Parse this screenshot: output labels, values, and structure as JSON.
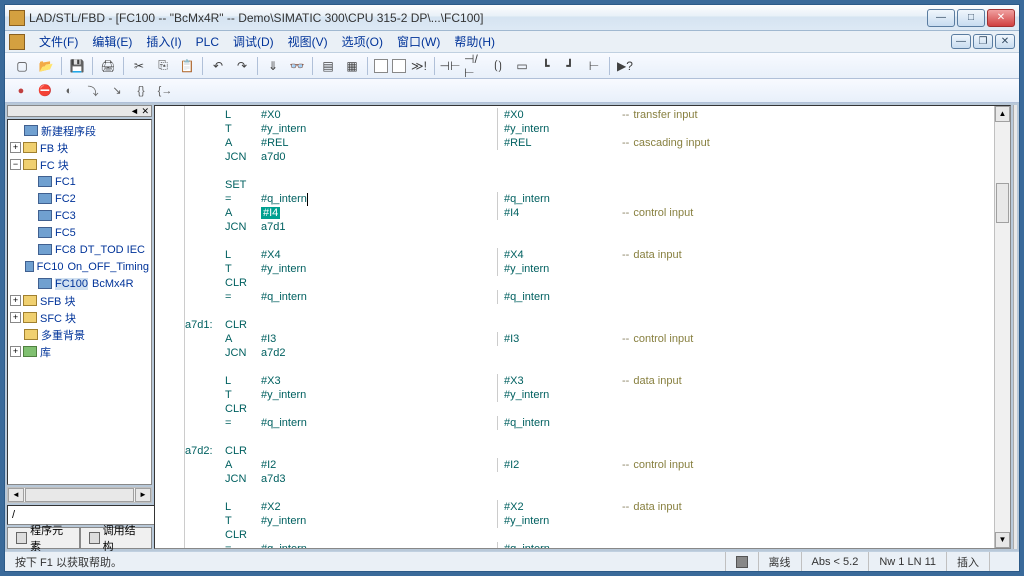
{
  "title": "LAD/STL/FBD  - [FC100 -- \"BcMx4R\" -- Demo\\SIMATIC 300\\CPU 315-2 DP\\...\\FC100]",
  "menu": {
    "file": "文件(F)",
    "edit": "编辑(E)",
    "insert": "插入(I)",
    "plc": "PLC",
    "debug": "调试(D)",
    "view": "视图(V)",
    "options": "选项(O)",
    "window": "窗口(W)",
    "help": "帮助(H)"
  },
  "tree": {
    "n0": "新建程序段",
    "n1": "FB 块",
    "n2": "FC 块",
    "fc1": "FC1",
    "fc2": "FC2",
    "fc3": "FC3",
    "fc5": "FC5",
    "fc8": "FC8",
    "fc8x": "DT_TOD   IEC",
    "fc10": "FC10",
    "fc10x": "On_OFF_Timing",
    "fc100": "FC100",
    "fc100x": "BcMx4R",
    "sfb": "SFB 块",
    "sfc": "SFC 块",
    "overlap": "多重背景",
    "lib": "库"
  },
  "tabs": {
    "elem": "程序元素",
    "call": "调用结构"
  },
  "code": [
    {
      "op": "L",
      "arg": "#X0",
      "ref": "#X0",
      "dash": "--",
      "cmt": "transfer input"
    },
    {
      "op": "T",
      "arg": "#y_intern",
      "ref": "#y_intern"
    },
    {
      "op": "A",
      "arg": "#REL",
      "ref": "#REL",
      "dash": "--",
      "cmt": "cascading input"
    },
    {
      "op": "JCN",
      "arg": "a7d0"
    },
    {},
    {
      "op": "SET"
    },
    {
      "op": "=",
      "arg": "#q_intern",
      "ref": "#q_intern",
      "caret": true
    },
    {
      "op": "A",
      "arg": "#I4",
      "ref": "#I4",
      "dash": "--",
      "cmt": "control input",
      "hilite": true
    },
    {
      "op": "JCN",
      "arg": "a7d1"
    },
    {},
    {
      "op": "L",
      "arg": "#X4",
      "ref": "#X4",
      "dash": "--",
      "cmt": "data input"
    },
    {
      "op": "T",
      "arg": "#y_intern",
      "ref": "#y_intern"
    },
    {
      "op": "CLR"
    },
    {
      "op": "=",
      "arg": "#q_intern",
      "ref": "#q_intern"
    },
    {},
    {
      "lbl": "a7d1:",
      "op": "CLR"
    },
    {
      "op": "A",
      "arg": "#I3",
      "ref": "#I3",
      "dash": "--",
      "cmt": "control input"
    },
    {
      "op": "JCN",
      "arg": "a7d2"
    },
    {},
    {
      "op": "L",
      "arg": "#X3",
      "ref": "#X3",
      "dash": "--",
      "cmt": "data input"
    },
    {
      "op": "T",
      "arg": "#y_intern",
      "ref": "#y_intern"
    },
    {
      "op": "CLR"
    },
    {
      "op": "=",
      "arg": "#q_intern",
      "ref": "#q_intern"
    },
    {},
    {
      "lbl": "a7d2:",
      "op": "CLR"
    },
    {
      "op": "A",
      "arg": "#I2",
      "ref": "#I2",
      "dash": "--",
      "cmt": "control input"
    },
    {
      "op": "JCN",
      "arg": "a7d3"
    },
    {},
    {
      "op": "L",
      "arg": "#X2",
      "ref": "#X2",
      "dash": "--",
      "cmt": "data input"
    },
    {
      "op": "T",
      "arg": "#y_intern",
      "ref": "#y_intern"
    },
    {
      "op": "CLR"
    },
    {
      "op": "=",
      "arg": "#q_intern",
      "ref": "#q_intern"
    }
  ],
  "status": {
    "hint": "按下 F1 以获取帮助。",
    "offline": "离线",
    "abs": "Abs < 5.2",
    "pos": "Nw 1  LN 11",
    "mode": "插入"
  },
  "input_value": "/"
}
